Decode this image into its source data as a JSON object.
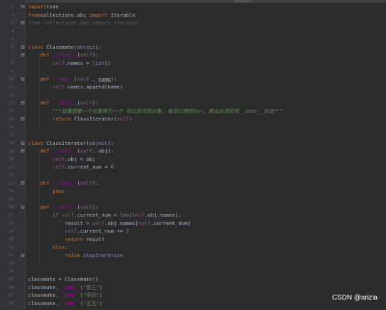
{
  "lines": [
    {
      "n": "1",
      "parts": [
        [
          "kw",
          "import"
        ],
        [
          "",
          "time"
        ]
      ]
    },
    {
      "n": "2",
      "parts": [
        [
          "kw",
          "from"
        ],
        [
          "",
          "collections.abc "
        ],
        [
          "kw",
          "import"
        ],
        [
          "",
          " Iterable"
        ]
      ]
    },
    {
      "n": "3",
      "parts": [
        [
          "dim",
          "from collections.abc import Iterator"
        ]
      ]
    },
    {
      "n": "4",
      "parts": []
    },
    {
      "n": "5",
      "parts": []
    },
    {
      "n": "6",
      "parts": [
        [
          "kw",
          "class "
        ],
        [
          "",
          "Classmate("
        ],
        [
          "builtin",
          "object"
        ],
        [
          "",
          "):"
        ]
      ]
    },
    {
      "n": "7",
      "parts": [
        [
          "",
          "    "
        ],
        [
          "kw",
          "def "
        ],
        [
          "dunder",
          "__init__"
        ],
        [
          "",
          "("
        ],
        [
          "self",
          "self"
        ],
        [
          "",
          "):"
        ]
      ]
    },
    {
      "n": "8",
      "parts": [
        [
          "",
          "        "
        ],
        [
          "self",
          "self"
        ],
        [
          "",
          ".names = "
        ],
        [
          "builtin",
          "list"
        ],
        [
          "",
          "()"
        ]
      ]
    },
    {
      "n": "9",
      "parts": []
    },
    {
      "n": "10",
      "parts": [
        [
          "",
          "    "
        ],
        [
          "kw",
          "def "
        ],
        [
          "dunder",
          "__add__"
        ],
        [
          "",
          "("
        ],
        [
          "self",
          "self"
        ],
        [
          "",
          " , "
        ],
        [
          "under",
          "name"
        ],
        [
          "",
          "):"
        ]
      ]
    },
    {
      "n": "11",
      "parts": [
        [
          "",
          "        "
        ],
        [
          "self",
          "self"
        ],
        [
          "",
          ".names.append(name)"
        ]
      ]
    },
    {
      "n": "12",
      "parts": []
    },
    {
      "n": "13",
      "parts": [
        [
          "",
          "    "
        ],
        [
          "kw",
          "def "
        ],
        [
          "dunder",
          "__iter__"
        ],
        [
          "",
          "("
        ],
        [
          "self",
          "self"
        ],
        [
          "",
          "):"
        ]
      ]
    },
    {
      "n": "14",
      "parts": [
        [
          "",
          "        "
        ],
        [
          "doc",
          "\"\"\"如果想要一个对象称为一个 可以迭代的对象, 既可以使用for, 那么必须实现__iter__方法\"\"\""
        ]
      ]
    },
    {
      "n": "15",
      "parts": [
        [
          "",
          "        "
        ],
        [
          "kw",
          "return "
        ],
        [
          "",
          "ClassIterator("
        ],
        [
          "self",
          "self"
        ],
        [
          "",
          ")"
        ]
      ]
    },
    {
      "n": "16",
      "parts": []
    },
    {
      "n": "17",
      "parts": []
    },
    {
      "n": "18",
      "parts": [
        [
          "kw",
          "class "
        ],
        [
          "",
          "ClassIterator("
        ],
        [
          "builtin",
          "object"
        ],
        [
          "",
          "):"
        ]
      ]
    },
    {
      "n": "19",
      "parts": [
        [
          "",
          "    "
        ],
        [
          "kw",
          "def "
        ],
        [
          "dunder",
          "__init__"
        ],
        [
          "",
          "("
        ],
        [
          "self",
          "self"
        ],
        [
          "",
          ", obj):"
        ]
      ]
    },
    {
      "n": "20",
      "parts": [
        [
          "",
          "        "
        ],
        [
          "self",
          "self"
        ],
        [
          "",
          ".obj = obj"
        ]
      ]
    },
    {
      "n": "21",
      "parts": [
        [
          "",
          "        "
        ],
        [
          "self",
          "self"
        ],
        [
          "",
          ".current_num = "
        ],
        [
          "num",
          "0"
        ]
      ]
    },
    {
      "n": "22",
      "parts": []
    },
    {
      "n": "23",
      "parts": [
        [
          "",
          "    "
        ],
        [
          "kw",
          "def "
        ],
        [
          "dunder",
          "__iter__"
        ],
        [
          "",
          "("
        ],
        [
          "self",
          "self"
        ],
        [
          "",
          "):"
        ]
      ]
    },
    {
      "n": "24",
      "parts": [
        [
          "",
          "        "
        ],
        [
          "kw",
          "pass"
        ]
      ]
    },
    {
      "n": "25",
      "parts": []
    },
    {
      "n": "26",
      "parts": [
        [
          "",
          "    "
        ],
        [
          "kw",
          "def "
        ],
        [
          "dunder",
          "__next__"
        ],
        [
          "",
          "("
        ],
        [
          "self",
          "self"
        ],
        [
          "",
          "):"
        ]
      ]
    },
    {
      "n": "27",
      "parts": [
        [
          "",
          "        "
        ],
        [
          "kw",
          "if "
        ],
        [
          "self",
          "self"
        ],
        [
          "",
          ".current_num < "
        ],
        [
          "builtin",
          "len"
        ],
        [
          "",
          "("
        ],
        [
          "self",
          "self"
        ],
        [
          "",
          ".obj.names):"
        ]
      ]
    },
    {
      "n": "28",
      "parts": [
        [
          "",
          "            result = "
        ],
        [
          "self",
          "self"
        ],
        [
          "",
          ".obj.names["
        ],
        [
          "self",
          "self"
        ],
        [
          "",
          ".current_num]"
        ]
      ]
    },
    {
      "n": "29",
      "parts": [
        [
          "",
          "            "
        ],
        [
          "self",
          "self"
        ],
        [
          "",
          ".current_num += "
        ],
        [
          "num",
          "1"
        ]
      ]
    },
    {
      "n": "30",
      "parts": [
        [
          "",
          "            "
        ],
        [
          "kw",
          "return "
        ],
        [
          "",
          "result"
        ]
      ]
    },
    {
      "n": "31",
      "parts": [
        [
          "",
          "        "
        ],
        [
          "kw",
          "else"
        ],
        [
          "",
          ":"
        ]
      ]
    },
    {
      "n": "32",
      "parts": [
        [
          "",
          "            "
        ],
        [
          "kw",
          "raise "
        ],
        [
          "builtin",
          "StopIteration"
        ]
      ]
    },
    {
      "n": "33",
      "parts": []
    },
    {
      "n": "34",
      "parts": []
    },
    {
      "n": "35",
      "parts": [
        [
          "",
          "classmate = Classmate()"
        ]
      ]
    },
    {
      "n": "36",
      "parts": [
        [
          "",
          "classmate."
        ],
        [
          "dunder",
          "__add__"
        ],
        [
          "",
          "("
        ],
        [
          "str",
          "\"张三\""
        ],
        [
          "",
          ")"
        ]
      ]
    },
    {
      "n": "37",
      "parts": [
        [
          "",
          "classmate."
        ],
        [
          "dunder",
          "__add__"
        ],
        [
          "",
          "("
        ],
        [
          "str",
          "\"李四\""
        ],
        [
          "",
          ")"
        ]
      ]
    },
    {
      "n": "38",
      "parts": [
        [
          "",
          "classmate."
        ],
        [
          "dunder",
          "__add__"
        ],
        [
          "",
          "("
        ],
        [
          "str",
          "\"王五\""
        ],
        [
          "",
          ")"
        ]
      ]
    }
  ],
  "watermark": "CSDN @arizia"
}
